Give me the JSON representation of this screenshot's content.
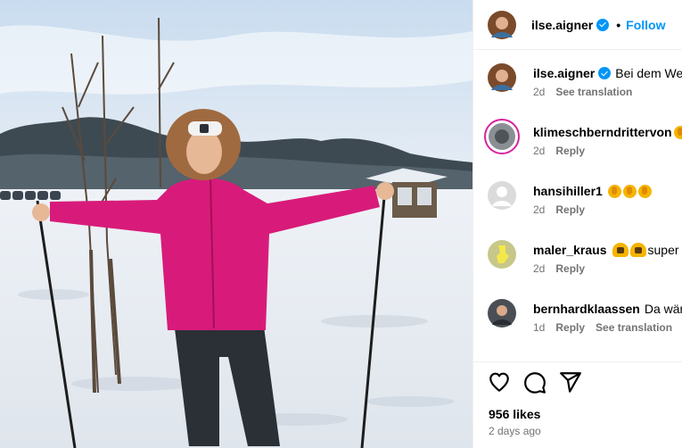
{
  "post": {
    "author": "ilse.aigner",
    "follow_label": "Follow",
    "separator": "•"
  },
  "comments": [
    {
      "user": "ilse.aigner",
      "text": "Bei dem Wett",
      "age": "2d",
      "action": "See translation",
      "verified": true
    },
    {
      "user": "klimeschberndrittervon",
      "text": "",
      "age": "2d",
      "action": "Reply"
    },
    {
      "user": "hansihiller1",
      "text": "",
      "age": "2d",
      "action": "Reply"
    },
    {
      "user": "maler_kraus",
      "text": "super",
      "age": "2d",
      "action": "Reply"
    },
    {
      "user": "bernhardklaassen",
      "text": "Da wäre",
      "age": "1d",
      "action": "Reply",
      "translate": "See translation"
    }
  ],
  "likes": "956 likes",
  "posted": "2 days ago",
  "colors": {
    "accent": "#0095f6",
    "jacket": "#d81b7a",
    "secondary_text": "#737373"
  },
  "icons": [
    "heart-icon",
    "comment-icon",
    "share-icon",
    "verified-icon"
  ]
}
